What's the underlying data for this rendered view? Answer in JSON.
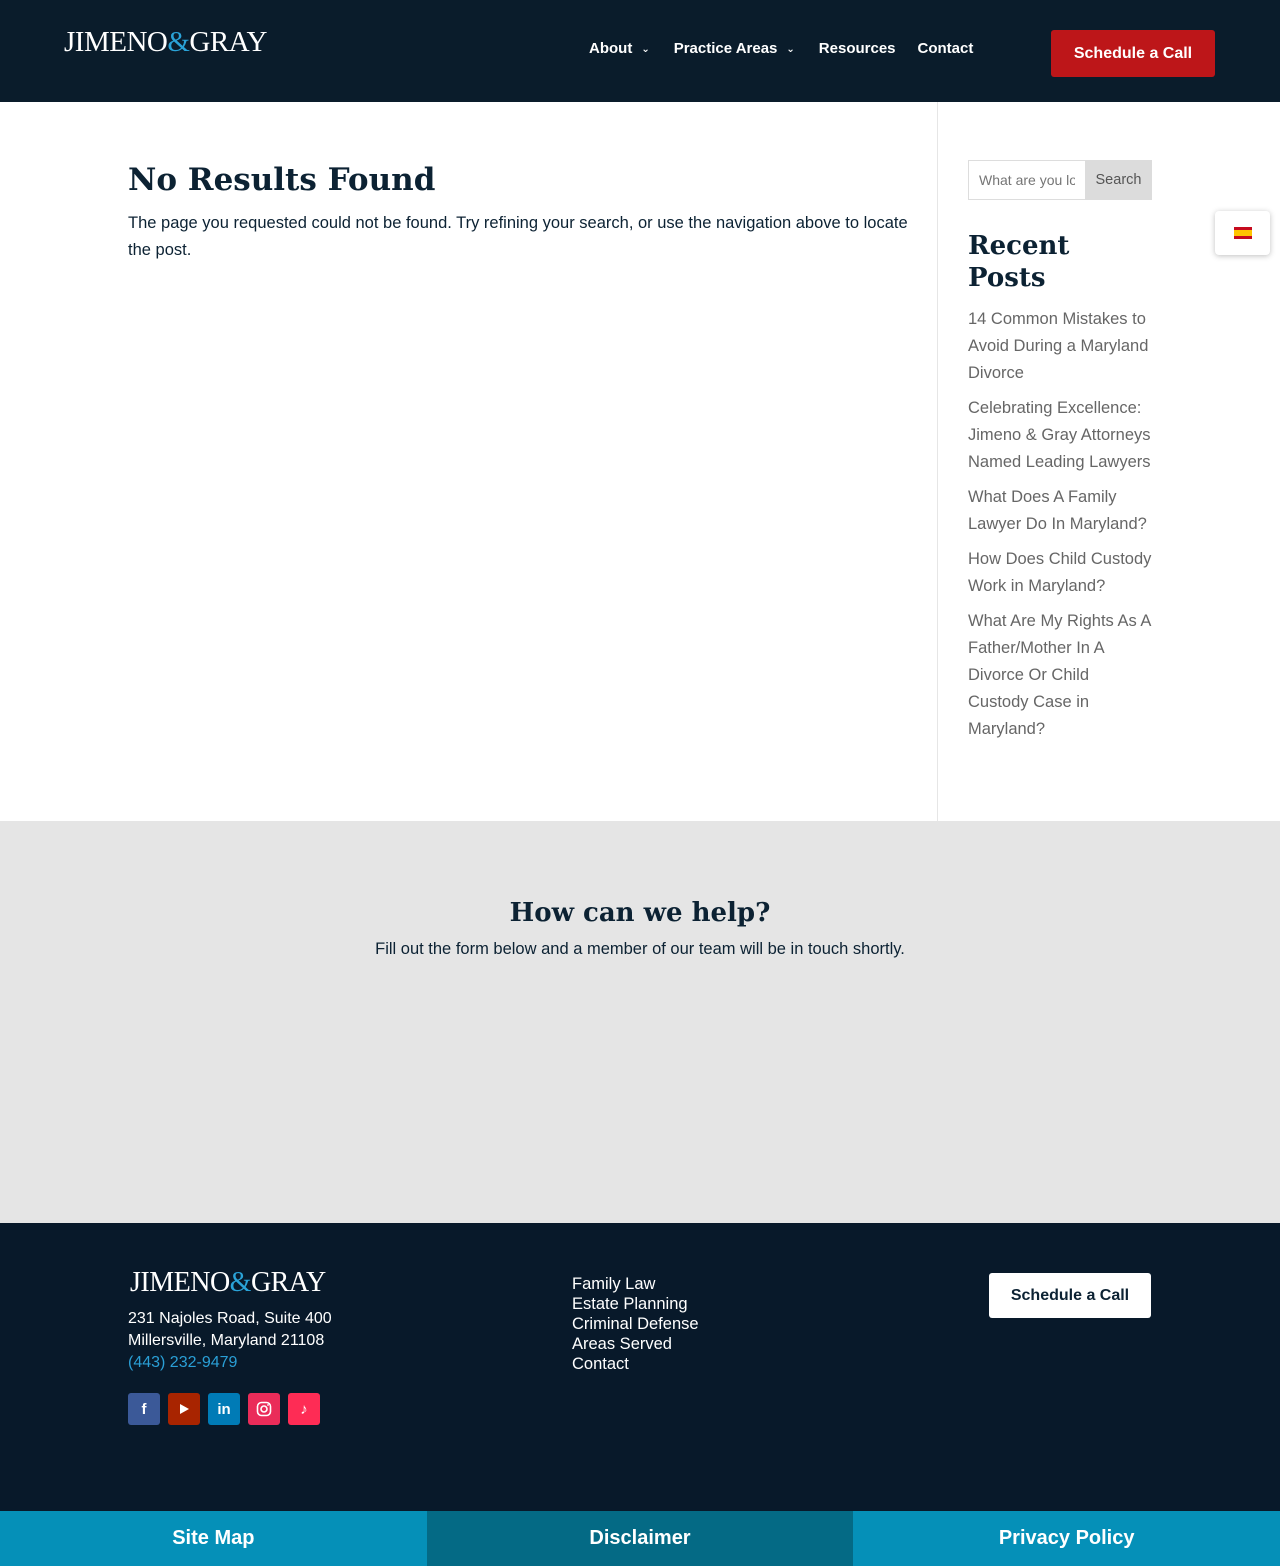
{
  "header": {
    "logo": {
      "left": "JIMENO",
      "amp": "&",
      "right": "GRAY"
    },
    "nav": [
      {
        "label": "About",
        "has_dropdown": true
      },
      {
        "label": "Practice Areas",
        "has_dropdown": true
      },
      {
        "label": "Resources",
        "has_dropdown": false
      },
      {
        "label": "Contact",
        "has_dropdown": false
      }
    ],
    "cta_label": "Schedule a Call"
  },
  "main": {
    "title": "No Results Found",
    "text": "The page you requested could not be found. Try refining your search, or use the navigation above to locate the post."
  },
  "sidebar": {
    "search": {
      "placeholder": "What are you looking for?",
      "button_label": "Search"
    },
    "recent_title": "Recent Posts",
    "posts": [
      "14 Common Mistakes to Avoid During a Maryland Divorce",
      "Celebrating Excellence: Jimeno & Gray Attorneys Named Leading Lawyers",
      "What Does A Family Lawyer Do In Maryland?",
      "How Does Child Custody Work in Maryland?",
      "What Are My Rights As A Father/Mother In A Divorce Or Child Custody Case in Maryland?"
    ]
  },
  "language": {
    "flag": "spain-flag-icon"
  },
  "help": {
    "title": "How can we help?",
    "text": "Fill out the form below and a member of our team will be in touch shortly."
  },
  "footer": {
    "logo": {
      "left": "JIMENO",
      "amp": "&",
      "right": "GRAY"
    },
    "address_line1": "231 Najoles Road, Suite 400",
    "address_line2": "Millersville, Maryland 21108",
    "phone": "(443) 232-9479",
    "socials": [
      {
        "icon": "facebook-icon",
        "glyph": "f",
        "color": "#3b5998"
      },
      {
        "icon": "youtube-icon",
        "glyph": "▶",
        "color": "#a82400"
      },
      {
        "icon": "linkedin-icon",
        "glyph": "in",
        "color": "#007bb6"
      },
      {
        "icon": "instagram-icon",
        "glyph": "◎",
        "color": "#ea2c59"
      },
      {
        "icon": "tiktok-icon",
        "glyph": "♪",
        "color": "#fe2c55"
      }
    ],
    "links": [
      "Family Law",
      "Estate Planning",
      "Criminal Defense",
      "Areas Served",
      "Contact"
    ],
    "cta_label": "Schedule a Call"
  },
  "bottom_bar": [
    "Site Map",
    "Disclaimer",
    "Privacy Policy"
  ],
  "colors": {
    "navy": "#0a1c2b",
    "accent_red": "#bd1619",
    "accent_blue": "#2aa3d8",
    "bottom_teal": "#0590b8",
    "bottom_teal_dark": "#046a85"
  }
}
